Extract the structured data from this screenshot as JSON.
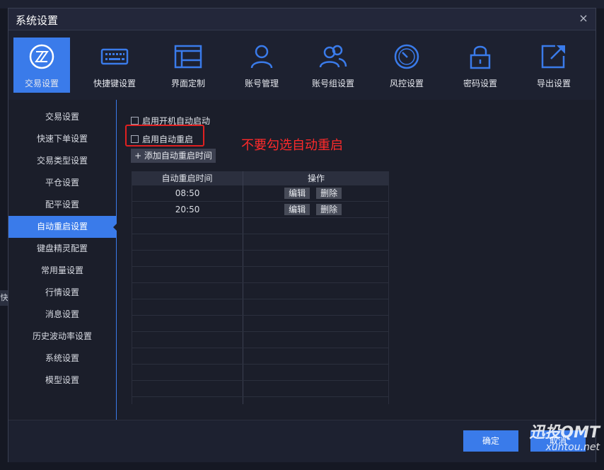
{
  "window": {
    "title": "系统设置",
    "close_glyph": "×"
  },
  "toolbar": {
    "items": [
      {
        "label": "交易设置",
        "icon": "trade-icon",
        "active": true
      },
      {
        "label": "快捷键设置",
        "icon": "keyboard-icon"
      },
      {
        "label": "界面定制",
        "icon": "layout-icon"
      },
      {
        "label": "账号管理",
        "icon": "user-icon"
      },
      {
        "label": "账号组设置",
        "icon": "user-group-icon"
      },
      {
        "label": "风控设置",
        "icon": "gauge-icon"
      },
      {
        "label": "密码设置",
        "icon": "lock-icon"
      },
      {
        "label": "导出设置",
        "icon": "export-icon"
      }
    ]
  },
  "sidebar": {
    "items": [
      {
        "label": "交易设置"
      },
      {
        "label": "快速下单设置"
      },
      {
        "label": "交易类型设置"
      },
      {
        "label": "平仓设置"
      },
      {
        "label": "配平设置"
      },
      {
        "label": "自动重启设置",
        "active": true
      },
      {
        "label": "键盘精灵配置"
      },
      {
        "label": "常用量设置"
      },
      {
        "label": "行情设置"
      },
      {
        "label": "消息设置"
      },
      {
        "label": "历史波动率设置"
      },
      {
        "label": "系统设置"
      },
      {
        "label": "模型设置"
      }
    ]
  },
  "content": {
    "startup_checkbox": "启用开机自动启动",
    "restart_checkbox": "启用自动重启",
    "annotation": "不要勾选自动重启",
    "add_button": "+ 添加自动重启时间",
    "table": {
      "headers": [
        "自动重启时间",
        "操作"
      ],
      "rows": [
        {
          "time": "08:50",
          "edit": "编辑",
          "delete": "删除"
        },
        {
          "time": "20:50",
          "edit": "编辑",
          "delete": "删除"
        }
      ]
    }
  },
  "footer": {
    "ok": "确定",
    "cancel": "取消"
  },
  "watermark": {
    "line1": "迅投QMT",
    "line2": "xuntou.net"
  },
  "background": {
    "left_tab": "快"
  },
  "colors": {
    "accent": "#3a7bea",
    "annotation": "#ff2a2a",
    "dialog_bg": "#1b1e2a"
  }
}
